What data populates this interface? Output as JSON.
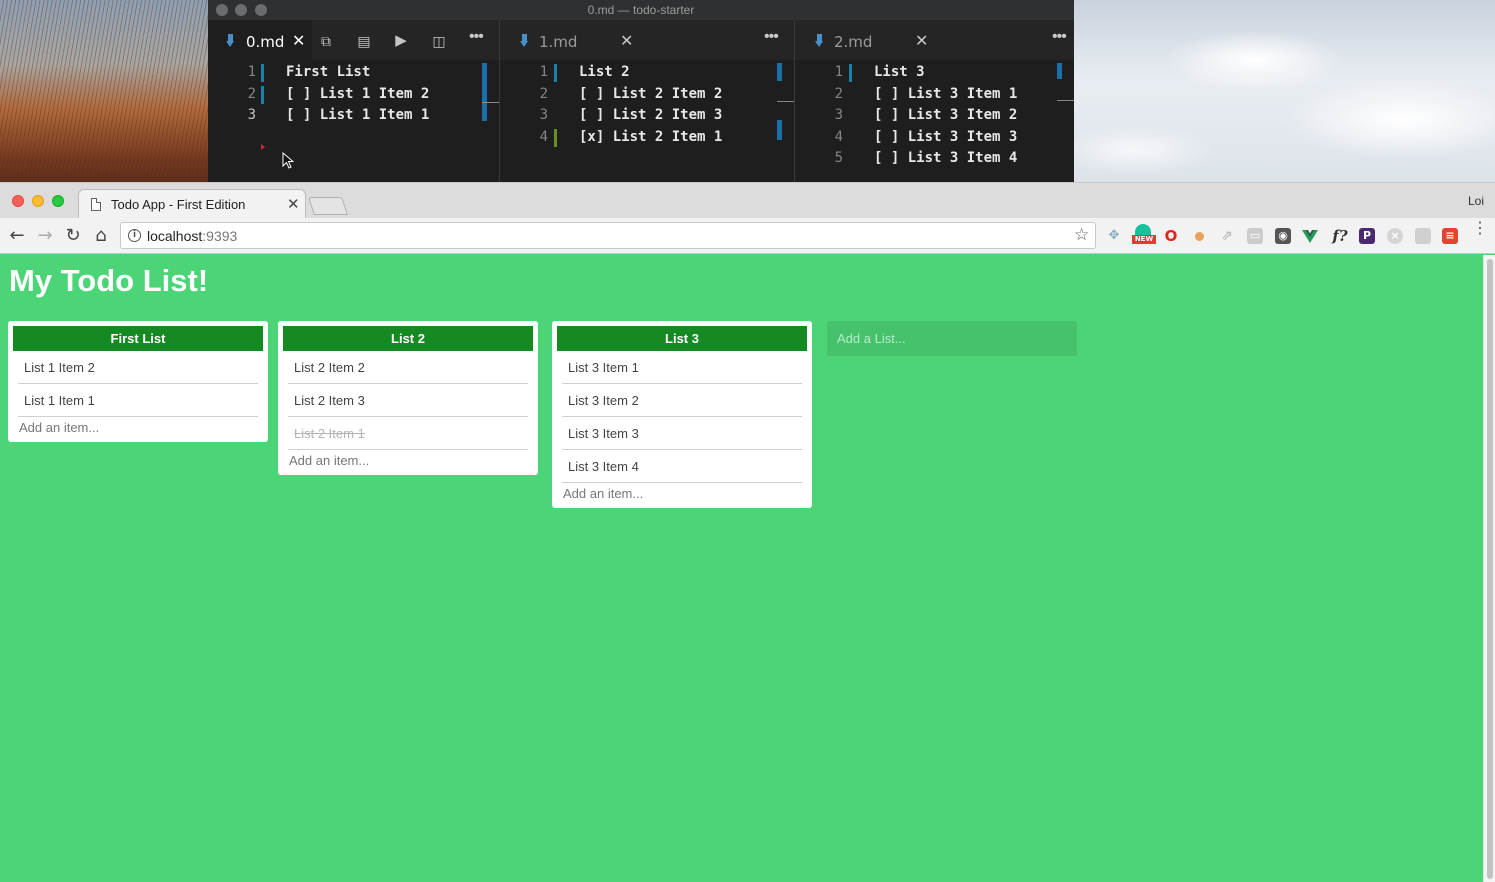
{
  "editor": {
    "title": "0.md — todo-starter",
    "panes": [
      {
        "tab": "0.md",
        "lines": [
          {
            "n": "1",
            "text": "First List"
          },
          {
            "n": "2",
            "text": "[ ] List 1 Item 2"
          },
          {
            "n": "3",
            "text": "[ ] List 1 Item 1"
          }
        ]
      },
      {
        "tab": "1.md",
        "lines": [
          {
            "n": "1",
            "text": "List 2"
          },
          {
            "n": "2",
            "text": "[ ] List 2 Item 2"
          },
          {
            "n": "3",
            "text": "[ ] List 2 Item 3"
          },
          {
            "n": "4",
            "text": "[x] List 2 Item 1"
          }
        ]
      },
      {
        "tab": "2.md",
        "lines": [
          {
            "n": "1",
            "text": "List 3"
          },
          {
            "n": "2",
            "text": "[ ] List 3 Item 1"
          },
          {
            "n": "3",
            "text": "[ ] List 3 Item 2"
          },
          {
            "n": "4",
            "text": "[ ] List 3 Item 3"
          },
          {
            "n": "5",
            "text": "[ ] List 3 Item 4"
          }
        ]
      }
    ]
  },
  "browser": {
    "tab_title": "Todo App - First Edition",
    "profile": "Loi",
    "url_host": "localhost",
    "url_port": ":9393"
  },
  "page": {
    "title": "My Todo List!",
    "lists": [
      {
        "name": "First List",
        "items": [
          {
            "text": "List 1 Item 2",
            "done": false
          },
          {
            "text": "List 1 Item 1",
            "done": false
          }
        ],
        "add_placeholder": "Add an item..."
      },
      {
        "name": "List 2",
        "items": [
          {
            "text": "List 2 Item 2",
            "done": false
          },
          {
            "text": "List 2 Item 3",
            "done": false
          },
          {
            "text": "List 2 Item 1",
            "done": true
          }
        ],
        "add_placeholder": "Add an item..."
      },
      {
        "name": "List 3",
        "items": [
          {
            "text": "List 3 Item 1",
            "done": false
          },
          {
            "text": "List 3 Item 2",
            "done": false
          },
          {
            "text": "List 3 Item 3",
            "done": false
          },
          {
            "text": "List 3 Item 4",
            "done": false
          }
        ],
        "add_placeholder": "Add an item..."
      }
    ],
    "add_list_placeholder": "Add a List..."
  },
  "colors": {
    "page_bg": "#4cd577",
    "list_header": "#158a22",
    "add_list_bg": "#45c26b"
  },
  "icons": {
    "nav": [
      "back-arrow-icon",
      "forward-arrow-icon",
      "reload-icon",
      "home-icon"
    ],
    "extensions": [
      "dropbox-icon",
      "grammarly-new-icon",
      "opera-icon",
      "cookie-icon",
      "link-icon",
      "cast-icon",
      "lastpass-icon",
      "vue-devtools-icon",
      "function-icon",
      "producthunt-icon",
      "close-circle-icon",
      "folder-icon",
      "todoist-icon"
    ]
  }
}
